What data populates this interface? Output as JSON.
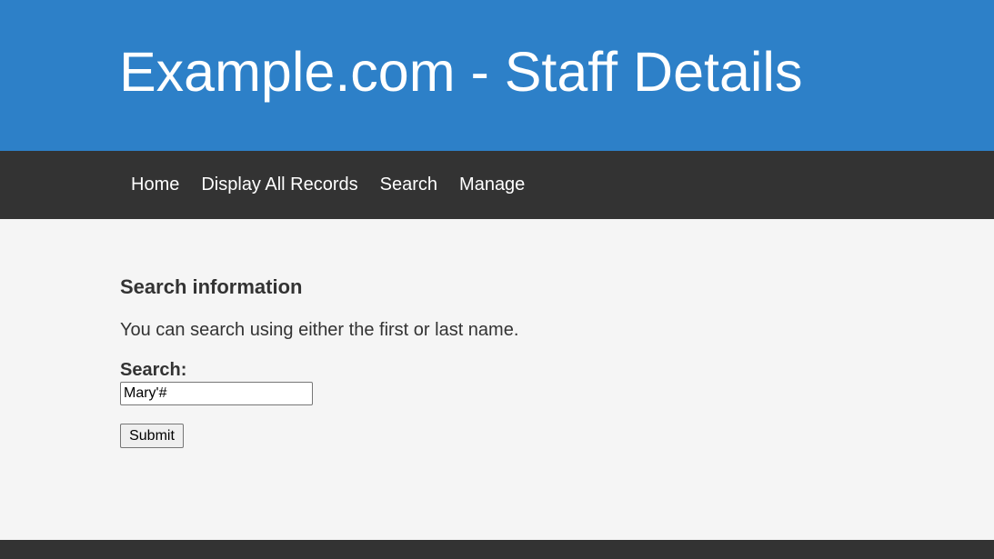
{
  "header": {
    "title": "Example.com - Staff Details"
  },
  "nav": {
    "items": [
      {
        "label": "Home"
      },
      {
        "label": "Display All Records"
      },
      {
        "label": "Search"
      },
      {
        "label": "Manage"
      }
    ]
  },
  "main": {
    "heading": "Search information",
    "info": "You can search using either the first or last name.",
    "search_label": "Search:",
    "search_value": "Mary'#",
    "submit_label": "Submit"
  },
  "colors": {
    "header_bg": "#2d80c8",
    "nav_bg": "#333333",
    "page_bg": "#f5f5f5",
    "footer_bg": "#333333"
  }
}
